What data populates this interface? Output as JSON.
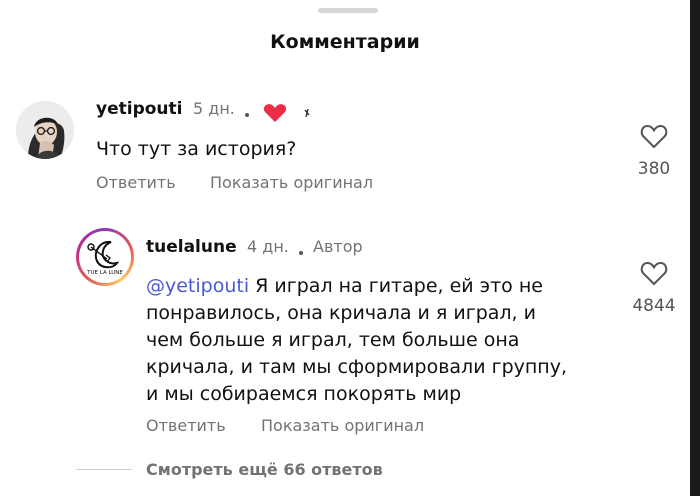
{
  "sheet": {
    "title": "Комментарии"
  },
  "comments": [
    {
      "username": "yetipouti",
      "time": "5 дн.",
      "text": "Что тут за история?",
      "actions": {
        "reply": "Ответить",
        "show_original": "Показать оригинал"
      },
      "likes": "380",
      "icons": {
        "reaction": "heart-icon",
        "like": "heart-outline-icon"
      }
    },
    {
      "username": "tuelalune",
      "time": "4 дн.",
      "author_tag": "Автор",
      "mention": "@yetipouti",
      "lines": [
        " Я играл на гитаре, ей это не",
        "понравилось, она кричала и я играл, и",
        "чем больше я играл, тем больше она",
        "кричала, и там мы сформировали группу,",
        "и мы собираемся покорять мир"
      ],
      "actions": {
        "reply": "Ответить",
        "show_original": "Показать оригинал"
      },
      "likes": "4844",
      "avatar_text": "TUE LA LUNE",
      "icons": {
        "like": "heart-outline-icon"
      }
    }
  ],
  "view_more": "Смотреть ещё 66 ответов",
  "colors": {
    "heart": "#ed2c45",
    "mention": "#4a5ad0",
    "muted": "#737373"
  }
}
